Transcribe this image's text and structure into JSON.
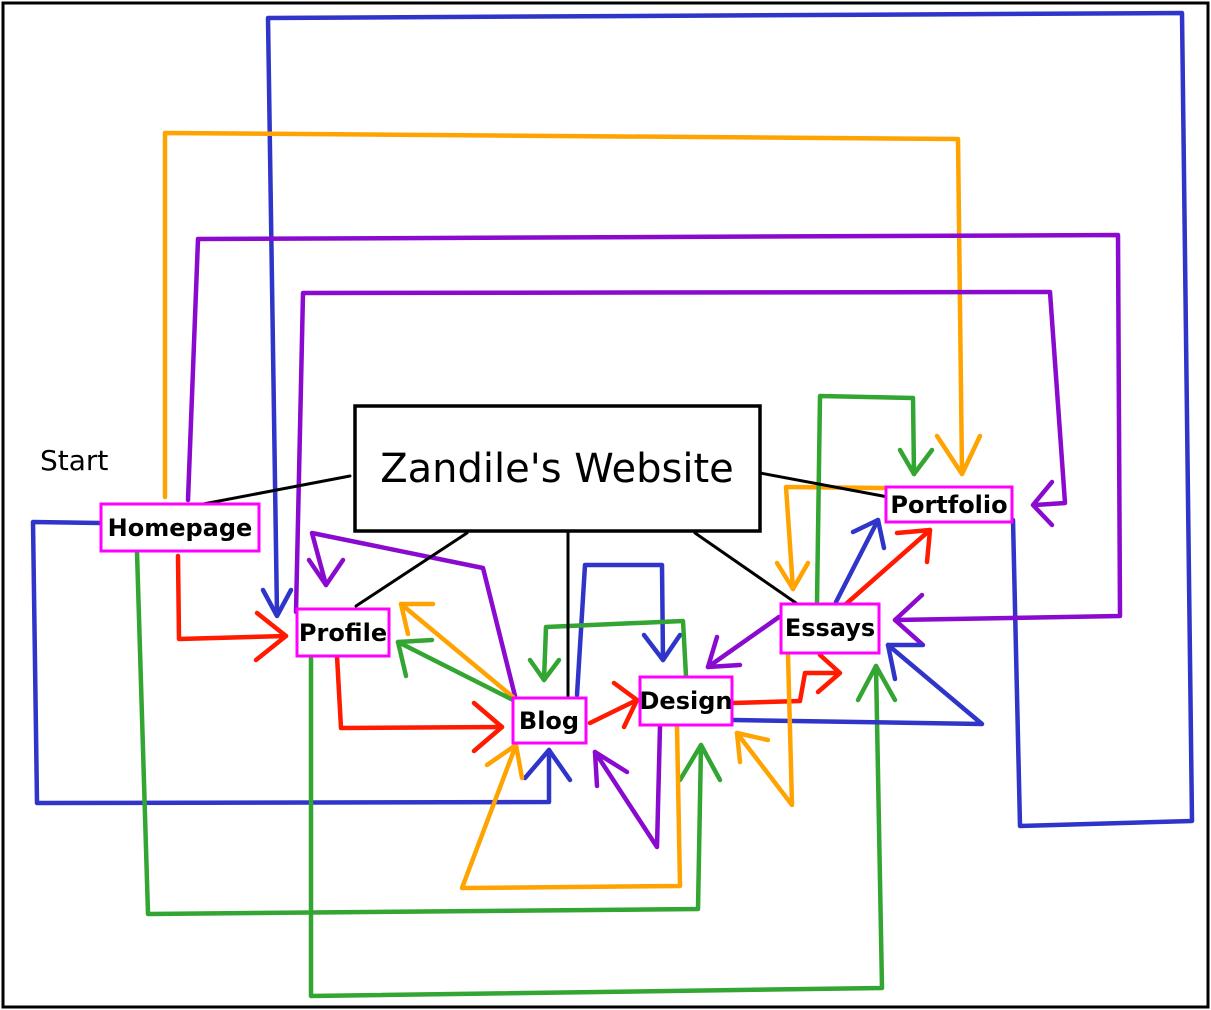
{
  "title": "Zandile's Website",
  "start_label": "Start",
  "nodes": {
    "homepage": "Homepage",
    "profile": "Profile",
    "blog": "Blog",
    "design": "Design",
    "essays": "Essays",
    "portfolio": "Portfolio"
  },
  "colors": {
    "frame": "#000000",
    "node_border": "#ff00ff",
    "red": "#ff1a00",
    "orange": "#ffa300",
    "green": "#33a532",
    "blue": "#2f35c8",
    "purple": "#8a0ad0"
  },
  "links": [
    {
      "from": "Homepage",
      "to": "Profile",
      "color": "red"
    },
    {
      "from": "Homepage",
      "to": "Portfolio",
      "color": "orange"
    },
    {
      "from": "Homepage",
      "to": "Essays",
      "color": "purple"
    },
    {
      "from": "Homepage",
      "to": "Blog",
      "color": "blue"
    },
    {
      "from": "Homepage",
      "to": "Design",
      "color": "green"
    },
    {
      "from": "Profile",
      "to": "Blog",
      "color": "red"
    },
    {
      "from": "Profile",
      "to": "Portfolio",
      "color": "purple"
    },
    {
      "from": "Profile",
      "to": "Essays",
      "color": "green"
    },
    {
      "from": "Blog",
      "to": "Profile",
      "color": "orange"
    },
    {
      "from": "Blog",
      "to": "Profile",
      "color": "green"
    },
    {
      "from": "Blog",
      "to": "Profile",
      "color": "purple"
    },
    {
      "from": "Blog",
      "to": "Design",
      "color": "red"
    },
    {
      "from": "Blog",
      "to": "Design",
      "color": "blue"
    },
    {
      "from": "Blog",
      "to": "Profile",
      "color": "blue"
    },
    {
      "from": "Design",
      "to": "Blog",
      "color": "green"
    },
    {
      "from": "Design",
      "to": "Blog",
      "color": "orange"
    },
    {
      "from": "Design",
      "to": "Blog",
      "color": "purple"
    },
    {
      "from": "Design",
      "to": "Essays",
      "color": "red"
    },
    {
      "from": "Design",
      "to": "Essays",
      "color": "blue"
    },
    {
      "from": "Essays",
      "to": "Design",
      "color": "purple"
    },
    {
      "from": "Essays",
      "to": "Design",
      "color": "orange"
    },
    {
      "from": "Essays",
      "to": "Portfolio",
      "color": "red"
    },
    {
      "from": "Essays",
      "to": "Portfolio",
      "color": "blue"
    },
    {
      "from": "Essays",
      "to": "Portfolio",
      "color": "green"
    },
    {
      "from": "Portfolio",
      "to": "Essays",
      "color": "orange"
    },
    {
      "from": "Portfolio",
      "to": "Profile",
      "color": "blue"
    }
  ]
}
